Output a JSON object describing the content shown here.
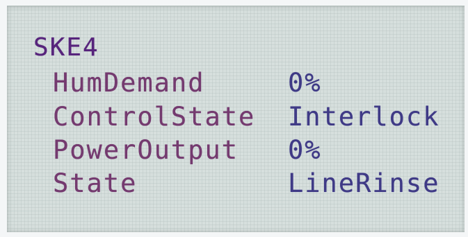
{
  "display": {
    "title": "SKE4",
    "rows": [
      {
        "label": "HumDemand",
        "value": "0%"
      },
      {
        "label": "ControlState",
        "value": "Interlock"
      },
      {
        "label": "PowerOutput",
        "value": "0%"
      },
      {
        "label": "State",
        "value": "LineRinse"
      }
    ]
  },
  "colors": {
    "lcd_background": "#d6dfdd",
    "title_text": "#57247c",
    "label_text": "#743a6f",
    "value_text": "#3f3a86"
  }
}
